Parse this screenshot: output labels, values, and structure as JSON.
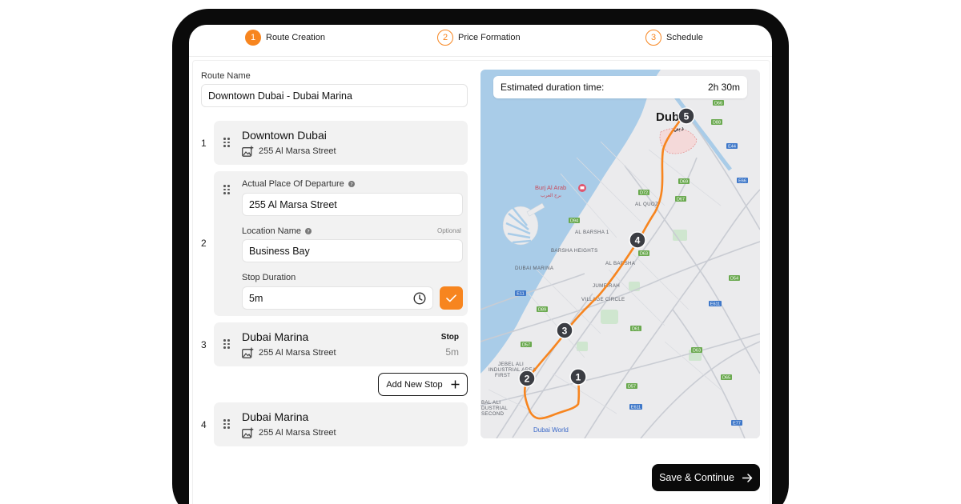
{
  "stepper": {
    "steps": [
      {
        "number": "1",
        "label": "Route Creation",
        "state": "active"
      },
      {
        "number": "2",
        "label": "Price Formation",
        "state": "pending"
      },
      {
        "number": "3",
        "label": "Schedule",
        "state": "pending"
      }
    ]
  },
  "form": {
    "route_name_label": "Route Name",
    "route_name_value": "Downtown Dubai - Dubai Marina",
    "stops": [
      {
        "index": "1",
        "title": "Downtown Dubai",
        "address": "255 Al Marsa Street"
      },
      {
        "index": "2",
        "departure_label": "Actual Place Of Departure",
        "departure_value": "255 Al Marsa Street",
        "location_label": "Location Name",
        "location_optional": "Optional",
        "location_value": "Business Bay",
        "duration_label": "Stop Duration",
        "duration_value": "5m"
      },
      {
        "index": "3",
        "title": "Dubai Marina",
        "address": "255 Al Marsa Street",
        "badge_label": "Stop",
        "badge_value": "5m"
      },
      {
        "index": "4",
        "title": "Dubai Marina",
        "address": "255 Al Marsa Street"
      }
    ],
    "add_stop_label": "Add New Stop"
  },
  "map": {
    "duration_label": "Estimated duration time:",
    "duration_value": "2h 30m",
    "labels": {
      "city": "Dub",
      "city_ar": "دبي",
      "burj": "Burj Al Arab",
      "burj_ar": "برج العرب",
      "al_quoz": "AL QUOZ",
      "al_barsha_1": "AL BARSHA 1",
      "barsha_heights": "BARSHA HEIGHTS",
      "al_barsha": "AL BARSHA",
      "dubai_marina": "DUBAI MARINA",
      "jvc": "JUMEIRAH",
      "jvc2": "VILLAGE CIRCLE",
      "jebel_ali_1": "JEBEL ALI",
      "jebel_ali_2": "INDUSTRIAL AREA",
      "jebel_ali_3": "FIRST",
      "jafza_1": "BAL ALI",
      "jafza_2": "DUSTRIAL",
      "jafza_3": "SECOND",
      "dubai_world": "Dubai World"
    },
    "markers": [
      "1",
      "2",
      "3",
      "4",
      "5"
    ],
    "road_badges": [
      "D66",
      "D88",
      "E44",
      "E66",
      "D69",
      "D72",
      "D67",
      "D94",
      "E11",
      "D63",
      "D54",
      "D61",
      "E611",
      "D57",
      "D63",
      "D65",
      "D57",
      "E611",
      "E77",
      "D89"
    ]
  },
  "actions": {
    "save_label": "Save & Continue"
  },
  "colors": {
    "accent": "#f7851f",
    "card": "#f2f2f2",
    "water": "#a5c9e7",
    "route": "#f7851f"
  }
}
